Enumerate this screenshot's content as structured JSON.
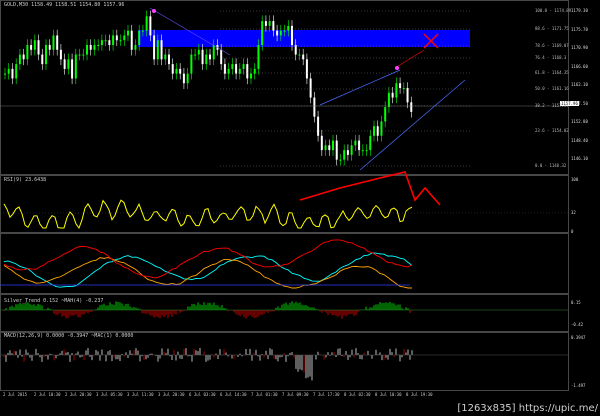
{
  "window": {
    "header": "GOLD,M30 1158.49 1158.51 1154.80 1157.96",
    "watermark": "[1263x835] https://upic.me/"
  },
  "panels": {
    "rsi": {
      "label": "RSI(9) 23.6438",
      "levels": [
        "100",
        "32",
        "0"
      ]
    },
    "osc": {
      "label": ""
    },
    "histogram": {
      "label": "Silver_Trend 0.152 ~MAH(4) -0.237",
      "levels": [
        "0.15",
        "-0.42"
      ]
    },
    "lower": {
      "label": "MACD(12,26,9) 0.0000 -0.3947 ~MAC(1) 0.0000",
      "levels": [
        "0.3947",
        "-1.497"
      ]
    }
  },
  "price_axis": {
    "current": "1157.96",
    "ticks": [
      "1179.30",
      "1175.70",
      "1170.90",
      "1166.60",
      "1162.10",
      "1157.50",
      "1152.80",
      "1148.40",
      "1146.10"
    ]
  },
  "fib_levels": [
    "100.0 - 1174.89",
    "88.6 - 1171.75",
    "78.6 - 1169.07",
    "76.4 - 1168.3",
    "61.8 - 1164.35",
    "50.0 - 1161.16",
    "38.2 - 1157.97",
    "23.6 - 1154.02",
    "0.0 - 1148.32"
  ],
  "time_axis": [
    "2 Jul 2015",
    "2 Jul 10:30",
    "2 Jul 20:30",
    "3 Jul 05:30",
    "3 Jul 11:30",
    "3 Jul 20:30",
    "6 Jul 03:30",
    "6 Jul 14:30",
    "7 Jul 01:30",
    "7 Jul 09:30",
    "7 Jul 17:30",
    "8 Jul 02:30",
    "8 Jul 10:30",
    "8 Jul 19:30"
  ],
  "chart_data": {
    "type": "line",
    "candle_close": [
      1166,
      1167,
      1165,
      1168,
      1170,
      1169,
      1172,
      1171,
      1173,
      1170,
      1168,
      1172,
      1171,
      1174,
      1171,
      1169,
      1167,
      1169,
      1165,
      1170,
      1170,
      1170,
      1172,
      1171,
      1172,
      1172,
      1173,
      1173,
      1172,
      1174,
      1173,
      1173,
      1174,
      1175,
      1171,
      1172,
      1175,
      1175,
      1178,
      1174,
      1169,
      1173,
      1169,
      1170,
      1168,
      1166,
      1167,
      1166,
      1164,
      1166,
      1170,
      1170,
      1171,
      1168,
      1170,
      1169,
      1172,
      1171,
      1168,
      1166,
      1167,
      1168,
      1166,
      1167,
      1168,
      1165,
      1166,
      1167,
      1172,
      1177,
      1176,
      1177,
      1175,
      1174,
      1175,
      1175,
      1176,
      1172,
      1170,
      1170,
      1169,
      1165,
      1161,
      1157,
      1153,
      1150,
      1151,
      1150,
      1152,
      1148,
      1148,
      1150,
      1149,
      1151,
      1152,
      1150,
      1150,
      1150,
      1153,
      1155,
      1153,
      1156,
      1159,
      1162,
      1161,
      1164,
      1163,
      1163,
      1160,
      1158
    ],
    "colors": {
      "bull": "#00ff00",
      "bear": "#ffffff",
      "resistance": "#0000ff",
      "rsi": "#ffff00",
      "signal_arrow": "#ff0000",
      "osc_fast": "#00ffff",
      "osc_mid": "#ffa500",
      "osc_slow": "#ff0000",
      "hist_up": "#00c800",
      "hist_down": "#c80000"
    }
  }
}
